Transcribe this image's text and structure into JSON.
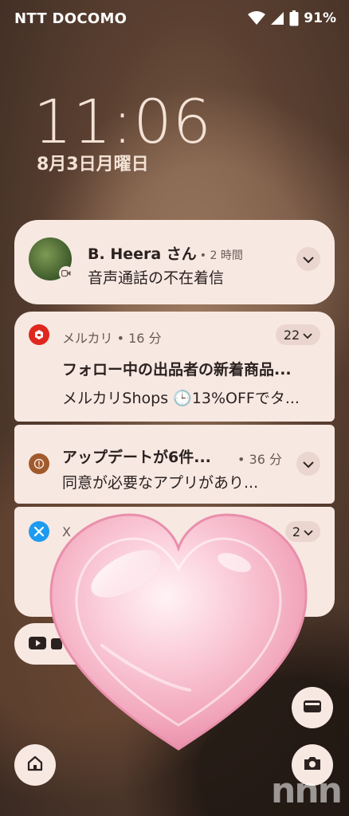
{
  "status_bar": {
    "carrier": "NTT DOCOMO",
    "battery": "91%"
  },
  "lockscreen": {
    "time": "11:06",
    "date": "8月3日月曜日"
  },
  "notifications": {
    "missed_call": {
      "name": "B. Heera さん",
      "time": "• 2 時間",
      "text": "音声通話の不在着信"
    },
    "mercari": {
      "app": "メルカリ • 16 分",
      "count": "22",
      "title": "フォロー中の出品者の新着商品...",
      "text": "メルカリShops 🕒13%OFFでタ..."
    },
    "update": {
      "title": "アップデートが6件...",
      "time": "• 36 分",
      "text": "同意が必要なアプリがあり..."
    },
    "x": {
      "app": "X",
      "count": "2"
    }
  },
  "watermark": "nnn",
  "colors": {
    "card_bg": "#f7e8e2",
    "pill_bg": "#ead6cf",
    "mercari_red": "#e0271e",
    "x_blue": "#1d9bf0",
    "update_brown": "#a15a2c"
  }
}
